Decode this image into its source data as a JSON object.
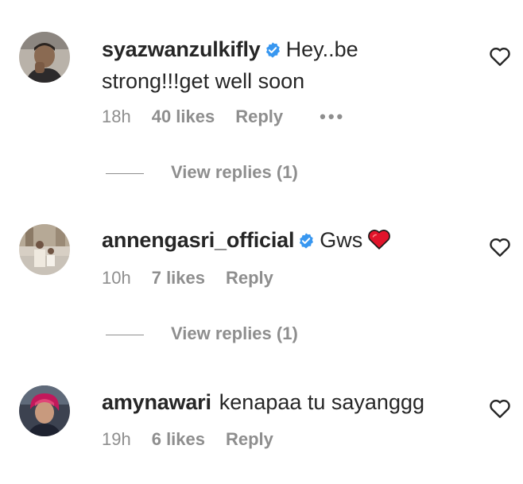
{
  "comments": [
    {
      "username": "syazwanzulkifly",
      "verified": true,
      "text": "Hey..be strong!!!get well soon",
      "time": "18h",
      "likes": "40 likes",
      "reply": "Reply",
      "more": "•••",
      "view_replies": "View replies (1)"
    },
    {
      "username": "annengasri_official",
      "verified": true,
      "text": "Gws",
      "emoji": "red-heart",
      "time": "10h",
      "likes": "7 likes",
      "reply": "Reply",
      "view_replies": "View replies (1)"
    },
    {
      "username": "amynawari",
      "verified": false,
      "text": "kenapaa tu sayanggg",
      "time": "19h",
      "likes": "6 likes",
      "reply": "Reply"
    }
  ],
  "icons": {
    "like": "heart-outline-icon",
    "verified": "verified-badge-icon"
  },
  "colors": {
    "text": "#262626",
    "muted": "#8e8e8e",
    "verified": "#3897f0",
    "heart_emoji": "#e0142b"
  }
}
